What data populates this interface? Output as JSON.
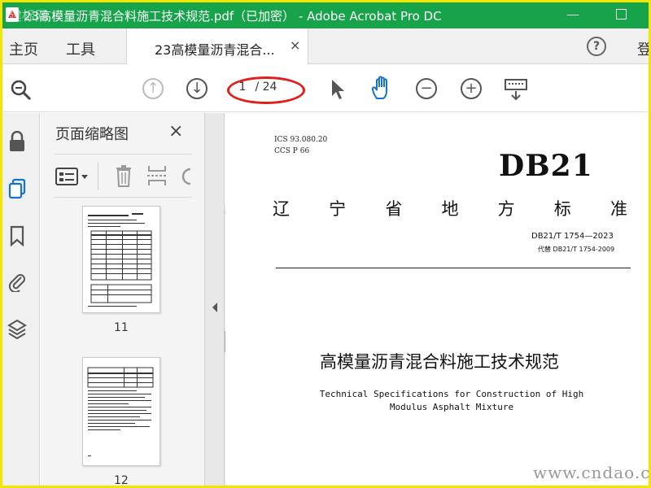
{
  "window": {
    "title": "23高模量沥青混合料施工技术规范.pdf（已加密） - Adobe Acrobat Pro DC",
    "watermark_corner": "建标网",
    "titlebar_color": "#16a34a"
  },
  "menubar": {
    "home": "主页",
    "tools": "工具",
    "doc_tab": "23高模量沥青混合...",
    "doc_tab_close": "×",
    "help": "?",
    "login": "登"
  },
  "toolbar": {
    "current_page": "1",
    "total_pages": "/ 24"
  },
  "thumbnails": {
    "panel_title": "页面缩略图",
    "close": "×",
    "pages": [
      {
        "label": "11"
      },
      {
        "label": "12"
      }
    ]
  },
  "document": {
    "ics": "ICS 93.080.20",
    "ccs": "CCS P 66",
    "db": "DB21",
    "province_chars": [
      "辽",
      "宁",
      "省",
      "地",
      "方",
      "标",
      "准"
    ],
    "standard_number": "DB21/T 1754—2023",
    "replaces": "代替 DB21/T 1754-2009",
    "title_cn": "高模量沥青混合料施工技术规范",
    "title_en_line1": "Technical Specifications for Construction of High",
    "title_en_line2": "Modulus Asphalt Mixture"
  },
  "watermark": "www.cndao.com",
  "icons": [
    "search-zoom-icon",
    "prev-page-icon",
    "next-page-icon",
    "select-arrow-icon",
    "hand-icon",
    "zoom-out-icon",
    "zoom-in-icon",
    "keyboard-icon",
    "lock-icon",
    "pages-icon",
    "bookmark-icon",
    "attachment-icon",
    "layers-icon",
    "thumbnail-options-icon",
    "trash-icon",
    "insert-page-icon",
    "rotate-icon"
  ]
}
